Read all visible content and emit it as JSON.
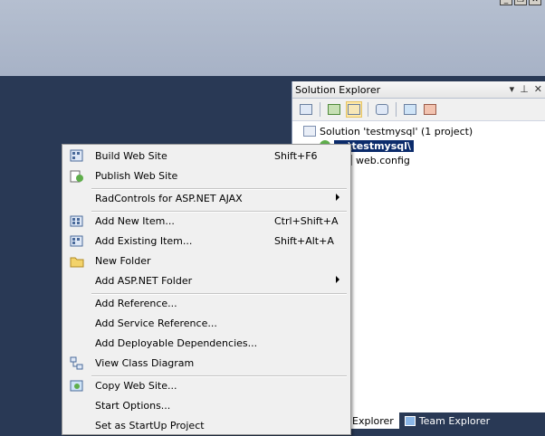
{
  "solution_explorer": {
    "title": "Solution Explorer",
    "solution_label": "Solution 'testmysql' (1 project)",
    "project_label": "...\\testmysql\\",
    "file_label": "web.config",
    "tabs": [
      "Explorer",
      "Team Explorer"
    ]
  },
  "context_menu": {
    "items": [
      {
        "label": "Build Web Site",
        "shortcut": "Shift+F6",
        "icon": "build-icon"
      },
      {
        "label": "Publish Web Site",
        "shortcut": "",
        "icon": "publish-icon"
      },
      {
        "label": "RadControls for ASP.NET AJAX",
        "shortcut": "",
        "icon": "",
        "submenu": true
      },
      {
        "label": "Add New Item...",
        "shortcut": "Ctrl+Shift+A",
        "icon": "new-item-icon"
      },
      {
        "label": "Add Existing Item...",
        "shortcut": "Shift+Alt+A",
        "icon": "existing-item-icon"
      },
      {
        "label": "New Folder",
        "shortcut": "",
        "icon": "folder-icon"
      },
      {
        "label": "Add ASP.NET Folder",
        "shortcut": "",
        "icon": "",
        "submenu": true
      },
      {
        "label": "Add Reference...",
        "shortcut": "",
        "icon": ""
      },
      {
        "label": "Add Service Reference...",
        "shortcut": "",
        "icon": ""
      },
      {
        "label": "Add Deployable Dependencies...",
        "shortcut": "",
        "icon": ""
      },
      {
        "label": "View Class Diagram",
        "shortcut": "",
        "icon": "class-diagram-icon"
      },
      {
        "label": "Copy Web Site...",
        "shortcut": "",
        "icon": "copy-web-icon"
      },
      {
        "label": "Start Options...",
        "shortcut": "",
        "icon": ""
      },
      {
        "label": "Set as StartUp Project",
        "shortcut": "",
        "icon": ""
      }
    ]
  }
}
